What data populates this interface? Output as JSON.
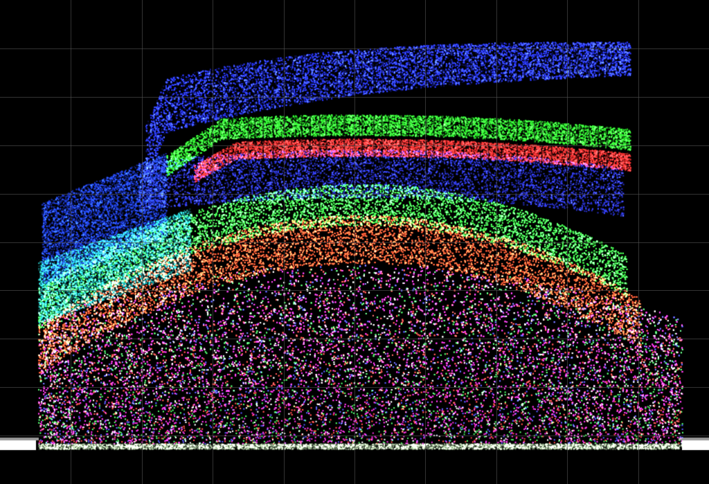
{
  "scope": {
    "type": "rgb-parade-waveform",
    "background_color": "#000000",
    "grid_color": "#555555",
    "grid_columns": 10,
    "grid_rows": 10
  },
  "channels": [
    {
      "name": "red",
      "color": "#ff2a2a"
    },
    {
      "name": "green",
      "color": "#2aff2a"
    },
    {
      "name": "blue",
      "color": "#2a3aff"
    }
  ]
}
